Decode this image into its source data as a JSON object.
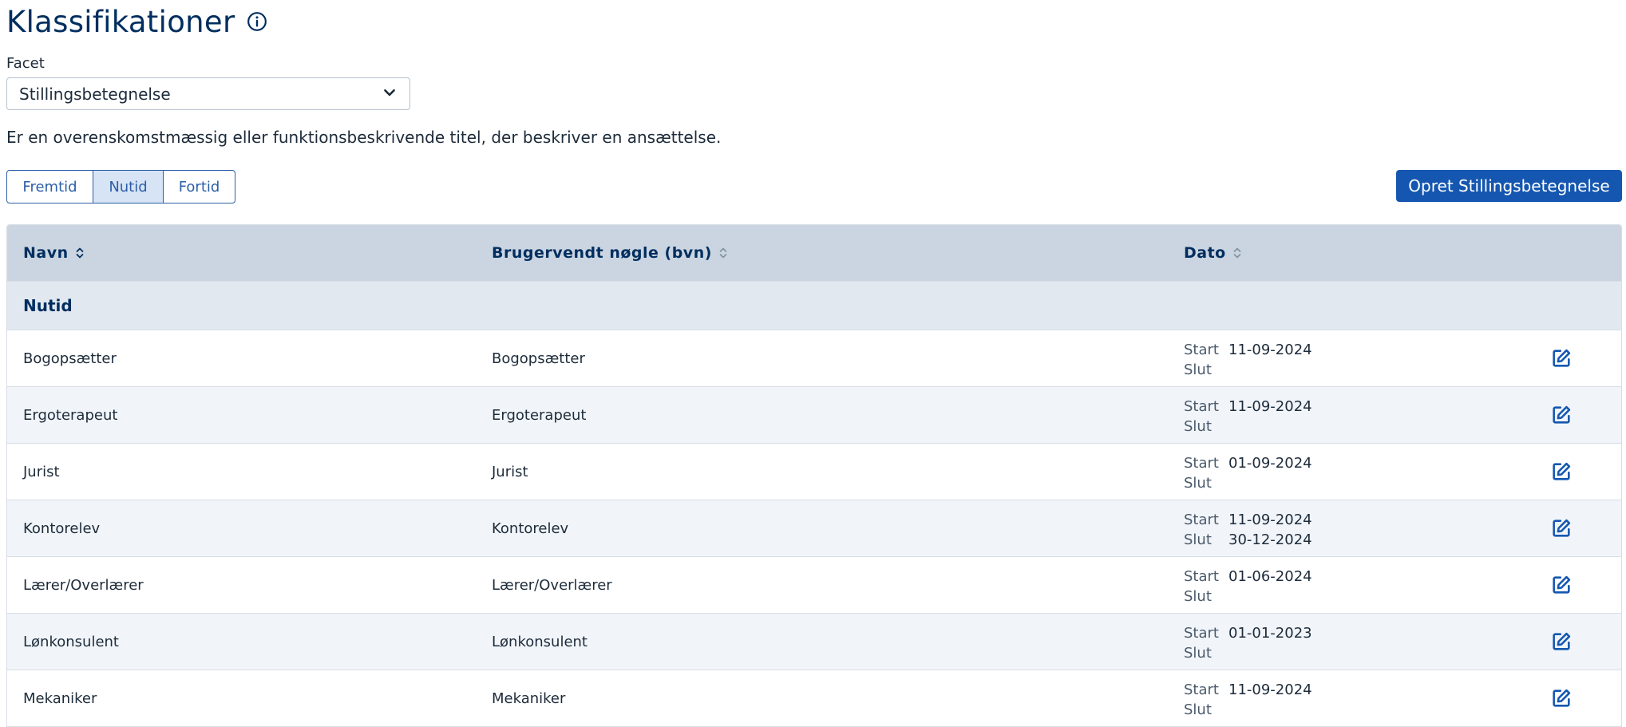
{
  "page": {
    "title": "Klassifikationer",
    "facet_label": "Facet",
    "facet_selected": "Stillingsbetegnelse",
    "description": "Er en overenskomstmæssig eller funktionsbeskrivende titel, der beskriver en ansættelse."
  },
  "tabs": [
    {
      "label": "Fremtid"
    },
    {
      "label": "Nutid"
    },
    {
      "label": "Fortid"
    }
  ],
  "create_button": "Opret Stillingsbetegnelse",
  "table": {
    "headers": {
      "name": "Navn",
      "bvn": "Brugervendt nøgle (bvn)",
      "date": "Dato"
    },
    "group": "Nutid",
    "start_label": "Start",
    "end_label": "Slut",
    "rows": [
      {
        "name": "Bogopsætter",
        "bvn": "Bogopsætter",
        "start": "11-09-2024",
        "end": ""
      },
      {
        "name": "Ergoterapeut",
        "bvn": "Ergoterapeut",
        "start": "11-09-2024",
        "end": ""
      },
      {
        "name": "Jurist",
        "bvn": "Jurist",
        "start": "01-09-2024",
        "end": ""
      },
      {
        "name": "Kontorelev",
        "bvn": "Kontorelev",
        "start": "11-09-2024",
        "end": "30-12-2024"
      },
      {
        "name": "Lærer/Overlærer",
        "bvn": "Lærer/Overlærer",
        "start": "01-06-2024",
        "end": ""
      },
      {
        "name": "Lønkonsulent",
        "bvn": "Lønkonsulent",
        "start": "01-01-2023",
        "end": ""
      },
      {
        "name": "Mekaniker",
        "bvn": "Mekaniker",
        "start": "11-09-2024",
        "end": ""
      }
    ]
  },
  "colors": {
    "primary": "#1557b0",
    "text": "#002e5f",
    "header_bg": "#cbd5e1",
    "group_bg": "#e2e8f0",
    "active_tab_bg": "#d7e4f6"
  },
  "icons": {
    "info": "info-circle-icon",
    "chevron": "chevron-down-icon",
    "sort": "sort-icon",
    "edit": "edit-icon"
  }
}
